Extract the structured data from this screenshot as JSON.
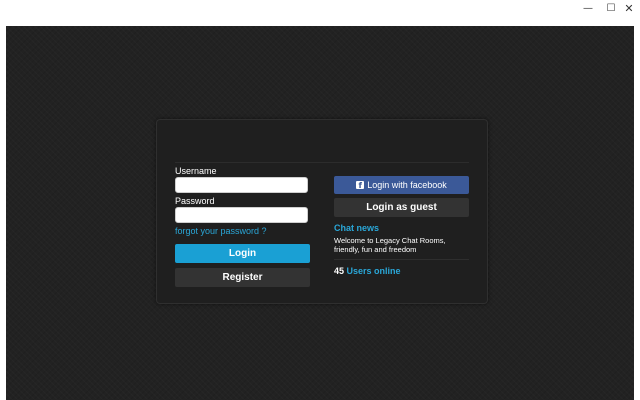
{
  "window": {
    "minimize_glyph": "—",
    "maximize_glyph": "☐",
    "close_glyph": "✕"
  },
  "login_form": {
    "username_label": "Username",
    "username_value": "",
    "password_label": "Password",
    "password_value": "",
    "forgot_link": "forgot your password ?",
    "login_button": "Login",
    "register_button": "Register"
  },
  "social": {
    "facebook_button": "Login with facebook",
    "facebook_icon": "facebook-icon",
    "guest_button": "Login as guest"
  },
  "news": {
    "title": "Chat news",
    "text": "Welcome to Legacy Chat Rooms, friendly, fun and freedom"
  },
  "online": {
    "count": "45",
    "label": "Users online"
  },
  "colors": {
    "accent": "#1aa0d4",
    "facebook": "#3b5998",
    "panel": "#1f1f1f",
    "background": "#222222"
  }
}
